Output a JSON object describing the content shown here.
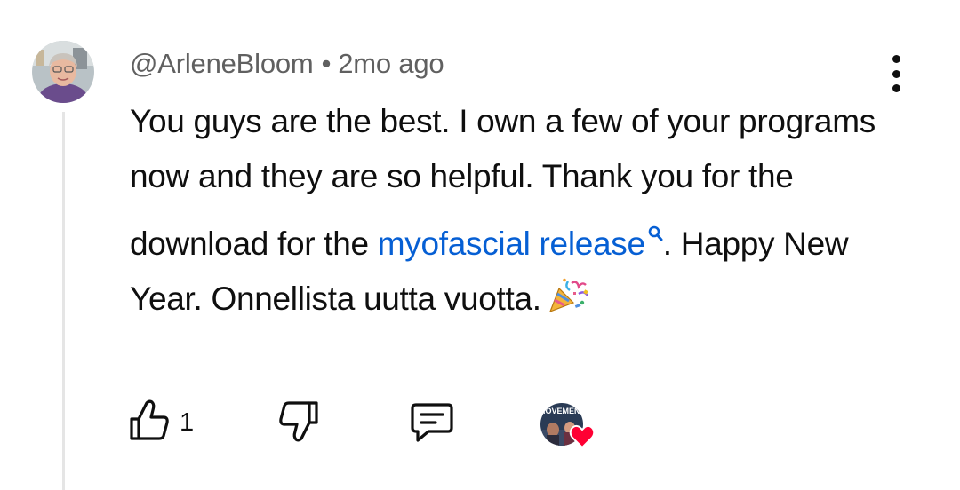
{
  "comment": {
    "author": "@ArleneBloom",
    "separator": "•",
    "timestamp": "2mo ago",
    "text_part1": "You guys are the best. I own a few of your programs now and they are so helpful. Thank you for the download for the ",
    "search_link": "myofascial release",
    "text_part2": ". Happy New Year. Onnellista uutta vuotta.",
    "emoji": "party-popper"
  },
  "actions": {
    "like_count": "1",
    "like_icon": "thumbs-up-icon",
    "dislike_icon": "thumbs-down-icon",
    "reply_icon": "reply-comment-icon",
    "creator_badge_text": "MOVEMENT"
  },
  "colors": {
    "link": "#065fd4",
    "meta_text": "#606060",
    "heart": "#ff0033"
  }
}
